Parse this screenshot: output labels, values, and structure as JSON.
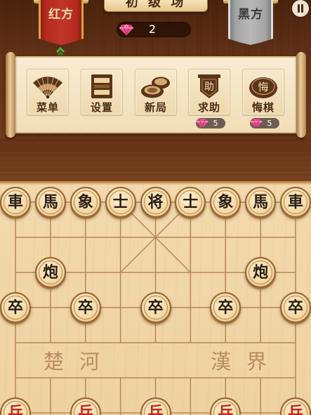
{
  "header": {
    "room_title": "初 级 场",
    "red_side_label": "红方",
    "black_side_label": "黑方",
    "gem_count": "2",
    "gem_icon": "gem-icon",
    "pause_icon": "pause-icon",
    "turn_indicator_icon": "chevron-up-icon",
    "turn_indicator_side": "red"
  },
  "toolbar": {
    "items": [
      {
        "label": "菜单",
        "icon": "fan-icon"
      },
      {
        "label": "设置",
        "icon": "frame-icon"
      },
      {
        "label": "新局",
        "icon": "stacked-discs-icon"
      },
      {
        "label": "求助",
        "icon": "help-banner-icon",
        "icon_text": "助",
        "cost": "5",
        "cost_icon": "gem-icon"
      },
      {
        "label": "悔棋",
        "icon": "undo-disc-icon",
        "icon_text": "悔",
        "cost": "5",
        "cost_icon": "gem-icon"
      }
    ]
  },
  "board": {
    "river_left": "楚河",
    "river_right": "漢界",
    "pieces": [
      {
        "char": "車",
        "side": "black",
        "file": 0,
        "rank": 0
      },
      {
        "char": "馬",
        "side": "black",
        "file": 1,
        "rank": 0
      },
      {
        "char": "象",
        "side": "black",
        "file": 2,
        "rank": 0
      },
      {
        "char": "士",
        "side": "black",
        "file": 3,
        "rank": 0
      },
      {
        "char": "将",
        "side": "black",
        "file": 4,
        "rank": 0
      },
      {
        "char": "士",
        "side": "black",
        "file": 5,
        "rank": 0
      },
      {
        "char": "象",
        "side": "black",
        "file": 6,
        "rank": 0
      },
      {
        "char": "馬",
        "side": "black",
        "file": 7,
        "rank": 0
      },
      {
        "char": "車",
        "side": "black",
        "file": 8,
        "rank": 0
      },
      {
        "char": "炮",
        "side": "black",
        "file": 1,
        "rank": 2
      },
      {
        "char": "炮",
        "side": "black",
        "file": 7,
        "rank": 2
      },
      {
        "char": "卒",
        "side": "black",
        "file": 0,
        "rank": 3
      },
      {
        "char": "卒",
        "side": "black",
        "file": 2,
        "rank": 3
      },
      {
        "char": "卒",
        "side": "black",
        "file": 4,
        "rank": 3
      },
      {
        "char": "卒",
        "side": "black",
        "file": 6,
        "rank": 3
      },
      {
        "char": "卒",
        "side": "black",
        "file": 8,
        "rank": 3
      },
      {
        "char": "兵",
        "side": "red",
        "file": 0,
        "rank": 6
      },
      {
        "char": "兵",
        "side": "red",
        "file": 2,
        "rank": 6
      },
      {
        "char": "兵",
        "side": "red",
        "file": 4,
        "rank": 6
      },
      {
        "char": "兵",
        "side": "red",
        "file": 6,
        "rank": 6
      },
      {
        "char": "兵",
        "side": "red",
        "file": 8,
        "rank": 6
      }
    ]
  },
  "colors": {
    "red_banner": "#b52a1f",
    "black_banner": "#a3a3a3",
    "red_piece_text": "#c2281b",
    "black_piece_text": "#2b1d12",
    "board": "#efd2a1",
    "grid_line": "#b5875a",
    "gem": "#ec4d8f",
    "turn_indicator": "#55b043"
  }
}
